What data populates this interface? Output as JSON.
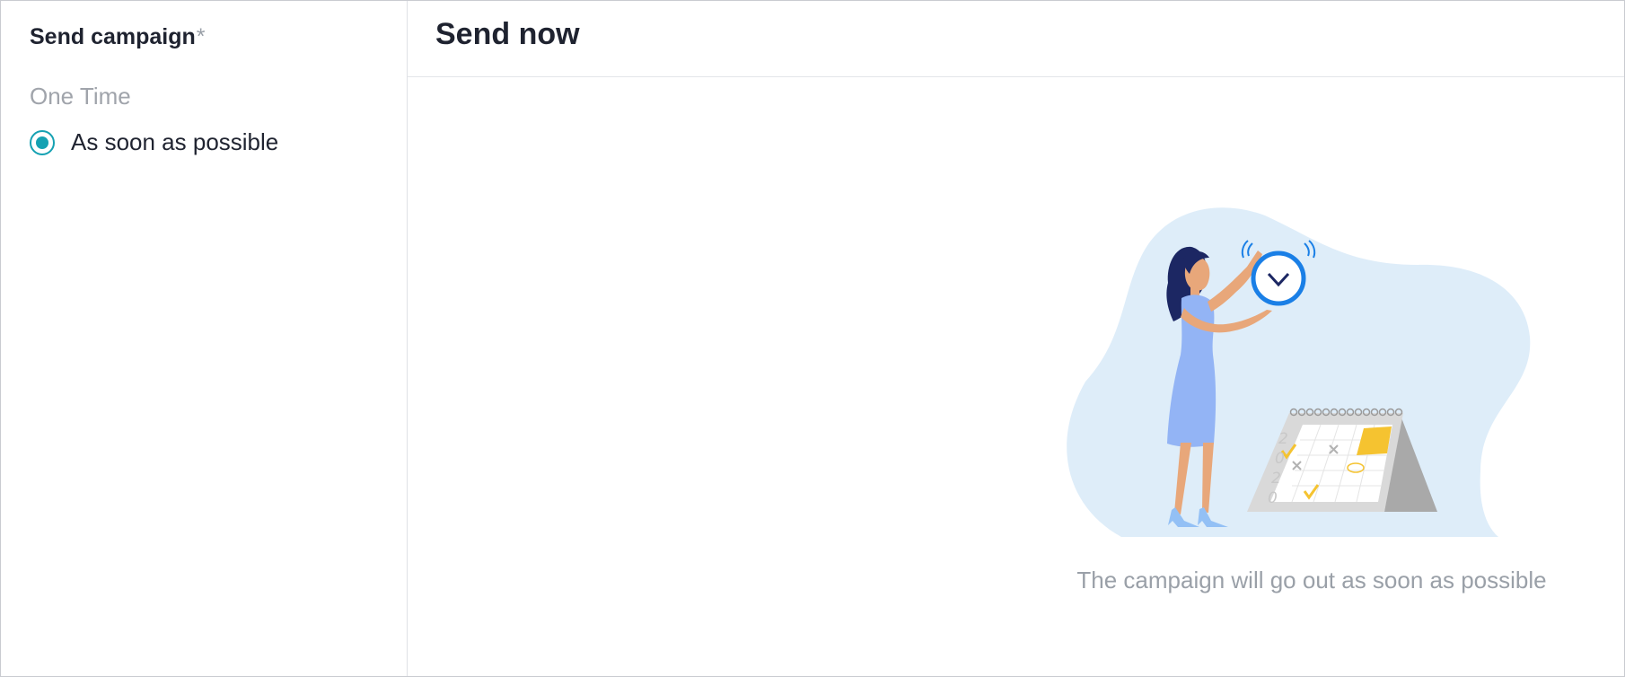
{
  "sidebar": {
    "section_title": "Send campaign",
    "required_mark": "*",
    "group_label": "One Time",
    "options": [
      {
        "label": "As soon as possible",
        "selected": true
      }
    ]
  },
  "main": {
    "title": "Send now",
    "caption": "The campaign will go out as soon as possible",
    "illustration": {
      "calendar_year_digits": [
        "2",
        "0",
        "2",
        "0"
      ]
    }
  },
  "colors": {
    "accent": "#15a1b2",
    "blob": "#deedf9",
    "clock": "#1a7fe6",
    "dress": "#93b4f5",
    "sticky_note": "#f5c330"
  }
}
